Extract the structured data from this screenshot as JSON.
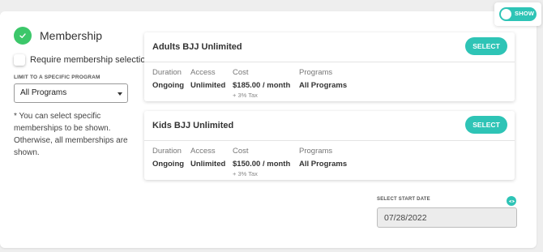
{
  "toggle": {
    "label": "SHOW",
    "on": true
  },
  "section": {
    "title": "Membership"
  },
  "require": {
    "label": "Require membership selection",
    "checked": false
  },
  "limit": {
    "label": "LIMIT TO A SPECIFIC PROGRAM",
    "selected": "All Programs"
  },
  "note": "* You can select specific memberships to be shown. Otherwise, all memberships are shown.",
  "columns": {
    "duration": "Duration",
    "access": "Access",
    "cost": "Cost",
    "programs": "Programs"
  },
  "memberships": [
    {
      "name": "Adults BJJ Unlimited",
      "select_label": "SELECT",
      "duration": "Ongoing",
      "access": "Unlimited",
      "cost": "$185.00 / month",
      "tax": "+ 3% Tax",
      "programs": "All Programs"
    },
    {
      "name": "Kids BJJ Unlimited",
      "select_label": "SELECT",
      "duration": "Ongoing",
      "access": "Unlimited",
      "cost": "$150.00 / month",
      "tax": "+ 3% Tax",
      "programs": "All Programs"
    }
  ],
  "start_date": {
    "label": "SELECT START DATE",
    "value": "07/28/2022"
  },
  "colors": {
    "accent": "#2ec4b6",
    "check": "#3cc76a"
  }
}
